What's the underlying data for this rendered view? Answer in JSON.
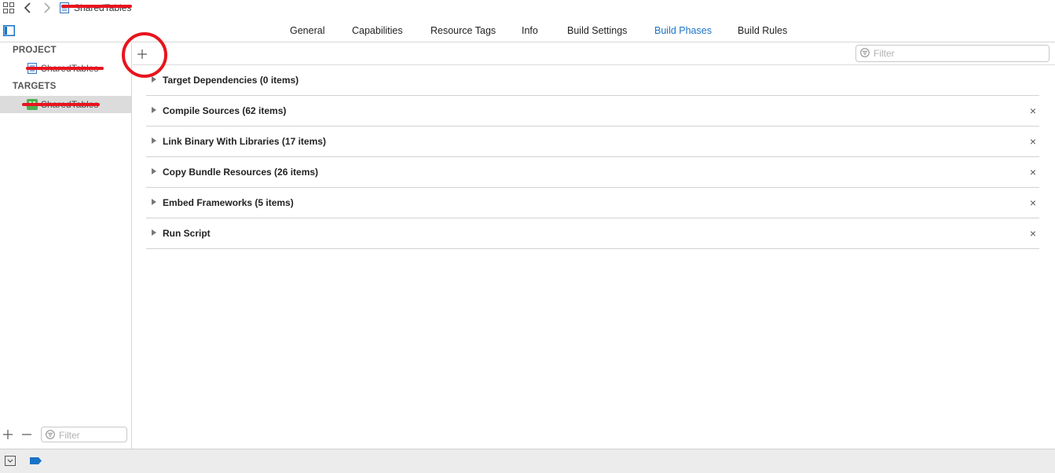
{
  "jumpbar": {
    "title": "SharedTables",
    "icons": {
      "grid": "related-items-icon",
      "back": "chevron-left-icon",
      "forward": "chevron-right-icon",
      "file": "project-file-icon"
    }
  },
  "tabs": [
    {
      "label": "General",
      "active": false
    },
    {
      "label": "Capabilities",
      "active": false
    },
    {
      "label": "Resource Tags",
      "active": false
    },
    {
      "label": "Info",
      "active": false
    },
    {
      "label": "Build Settings",
      "active": false
    },
    {
      "label": "Build Phases",
      "active": true
    },
    {
      "label": "Build Rules",
      "active": false
    }
  ],
  "sidebar": {
    "project_header": "PROJECT",
    "project_item": "SharedTables",
    "targets_header": "TARGETS",
    "target_item": "SharedTables",
    "filter_placeholder": "Filter"
  },
  "main": {
    "filter_placeholder": "Filter",
    "phases": [
      {
        "label": "Target Dependencies (0 items)",
        "removable": false
      },
      {
        "label": "Compile Sources (62 items)",
        "removable": true
      },
      {
        "label": "Link Binary With Libraries (17 items)",
        "removable": true
      },
      {
        "label": "Copy Bundle Resources (26 items)",
        "removable": true
      },
      {
        "label": "Embed Frameworks (5 items)",
        "removable": true
      },
      {
        "label": "Run Script",
        "removable": true
      }
    ],
    "close_glyph": "×"
  },
  "colors": {
    "accent": "#1a73c8",
    "annotation_red": "#e8141e",
    "selection": "#dcdcdc",
    "target_icon": "#4caf50"
  }
}
